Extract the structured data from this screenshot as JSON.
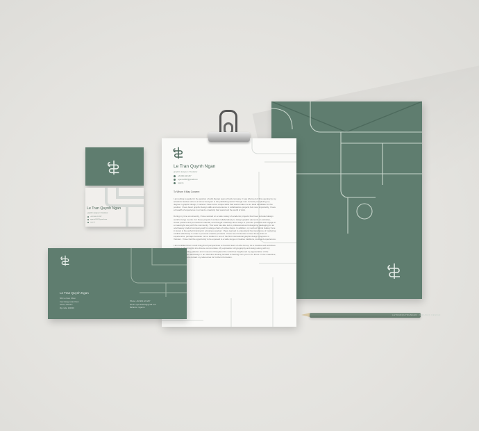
{
  "brand": {
    "name": "Le Tran Quynh Ngan",
    "role": "graphic designer / illustrator",
    "colors": {
      "primary_green": "#5f7d6f",
      "paper": "#fafaf8",
      "background": "#e6e5e1"
    }
  },
  "letterhead": {
    "contacts": [
      "+84 964 423 297",
      "ngan.le2097@gmail.com",
      "ngan.le"
    ],
    "salutation": "To Whom It May Concern:",
    "paragraphs": [
      "I am writing to apply for the position of AAA Design team of AAA company. I was informed of this opening by my academic adviser who is a former designer in the publishing world. Though I am currently completing my degree in graphic design, I believe I have some unique skills that would make me an ideal candidate for this position. I have basic graphic design skills and experience in collaborative projects but more importantly, I have a breadth of experience in art and a creativity that would suit the world of AAA.",
      "During my time at university, I have worked on a wide variety of academic projects that have included design work for large events. For these projects I worked collaboratively to design graphic elements on websites, create posters and promotional material, and thought creatively about ways to promote products and engage in a meaningful way with the community. This work has also led to professional work designing packaging for an ocal beauty product company and for a large chain of coffee shops. In addition, my work at Muriel Gallery here in Hanoi is the perfect training for a business and art. I have learned to understand the importance of marketing exhibits effectively in order to promote creative products. I have been fortunate to have these kinds of experiences, perhaps because I am a student in one of the first international graphic design programs in Vietnam. I have had the opportunity to be exposed to a wide range of creative traditions, tools and experiences.",
      "I am confident that I could bring fresh perspectives to the AAA team of AAA Group. As a creative and ambitious woman, I offer insights into diverse communities. My exploration of typography and design along with my extensive traveling galleries and museums throughout the world has heightened my appreciation of the possibilities of art and design. I am therefore looking forward to hearing from you in the future. In the meantime, please feel free to contact my references for further information."
    ]
  },
  "business_card": {
    "contacts": [
      "+84 964 423 297",
      "ngan.le2097@gmail.com",
      "ngan.le"
    ]
  },
  "small_envelope": {
    "address": [
      "56C Lo Nam Chien",
      "Cau Giang, Hoan Kiem",
      "Hanoi, Vietnam",
      "Zip code: 100000"
    ],
    "contacts": [
      "Phone:   +84 964 423 297",
      "Email:   ngan.le2097@gmail.com",
      "Behance:  /ngan.le"
    ]
  },
  "pencil": {
    "text": "LETRANQUYNHNGAN · GRAPHIC DESIGN"
  }
}
